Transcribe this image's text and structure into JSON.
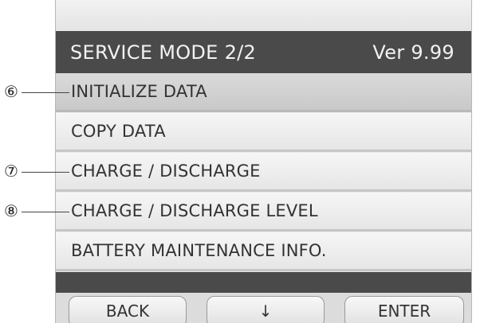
{
  "header": {
    "title": "SERVICE MODE 2/2",
    "version": "Ver 9.99"
  },
  "menu": [
    {
      "label": "INITIALIZE DATA"
    },
    {
      "label": "COPY DATA"
    },
    {
      "label": "CHARGE / DISCHARGE"
    },
    {
      "label": "CHARGE / DISCHARGE LEVEL"
    },
    {
      "label": "BATTERY MAINTENANCE  INFO."
    }
  ],
  "softkeys": {
    "back": "BACK",
    "down": "↓",
    "enter": "ENTER"
  },
  "callouts": {
    "c6": "⑥",
    "c7": "⑦",
    "c8": "⑧"
  }
}
